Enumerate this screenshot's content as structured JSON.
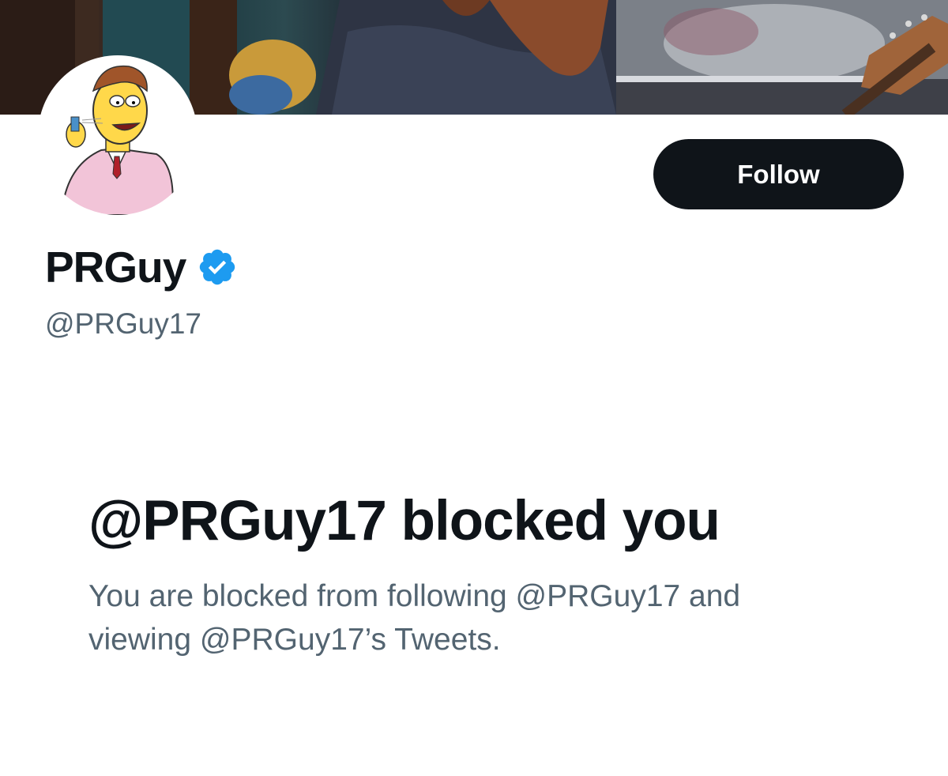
{
  "profile": {
    "display_name": "PRGuy",
    "handle": "@PRGuy17",
    "verified": true
  },
  "actions": {
    "follow_label": "Follow"
  },
  "blocked": {
    "title": "@PRGuy17 blocked you",
    "description": "You are blocked from following @PRGuy17 and viewing @PRGuy17’s Tweets."
  },
  "colors": {
    "text_primary": "#0f1419",
    "text_secondary": "#536471",
    "verified_blue": "#1d9bf0",
    "button_bg": "#0f1419",
    "background": "#ffffff"
  },
  "icons": {
    "verified": "verified-badge-icon"
  }
}
